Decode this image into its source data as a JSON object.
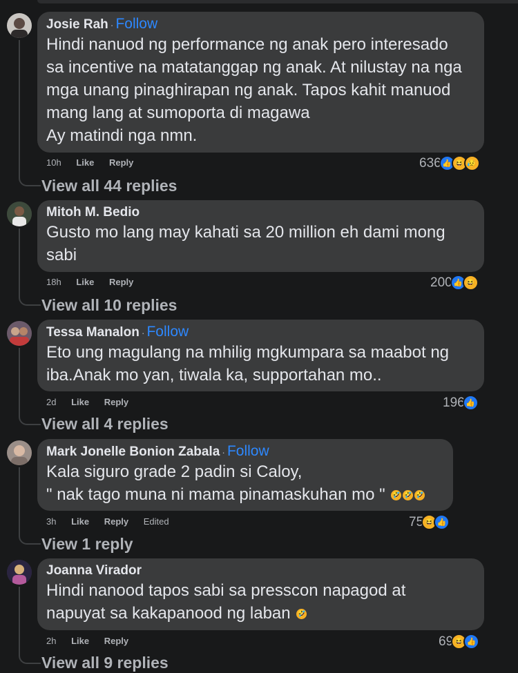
{
  "comments": [
    {
      "name": "Josie Rah",
      "follow": "Follow",
      "lines": [
        "Hindi nanuod ng performance ng anak pero interesado",
        "sa incentive na matatanggap ng anak. At nilustay na nga",
        "mga unang pinaghirapan ng anak. Tapos kahit manuod",
        "mang lang at sumoporta di magawa",
        "Ay matindi nga nmn."
      ],
      "time": "10h",
      "like": "Like",
      "reply": "Reply",
      "count": "636",
      "reactions": [
        "like-icon",
        "haha-icon",
        "sad-icon"
      ],
      "view_replies": "View all 44 replies"
    },
    {
      "name": "Mitoh M. Bedio",
      "lines": [
        "Gusto mo lang may kahati sa 20 million eh dami mong",
        "sabi"
      ],
      "time": "18h",
      "like": "Like",
      "reply": "Reply",
      "count": "200",
      "reactions": [
        "like-icon",
        "haha-icon"
      ],
      "view_replies": "View all 10 replies"
    },
    {
      "name": "Tessa Manalon",
      "follow": "Follow",
      "lines": [
        "Eto ung magulang na mhilig mgkumpara sa maabot ng",
        "iba.Anak mo yan, tiwala ka, supportahan mo.."
      ],
      "time": "2d",
      "like": "Like",
      "reply": "Reply",
      "count": "196",
      "reactions": [
        "like-icon"
      ],
      "view_replies": "View all 4 replies"
    },
    {
      "name": "Mark Jonelle Bonion Zabala",
      "follow": "Follow",
      "lines": [
        "Kala siguro grade 2 padin si Caloy,",
        "\" nak tago muna ni mama pinamaskuhan mo \""
      ],
      "time": "3h",
      "like": "Like",
      "reply": "Reply",
      "edited": "Edited",
      "count": "75",
      "reactions": [
        "haha-icon",
        "like-icon"
      ],
      "view_replies": "View 1 reply"
    },
    {
      "name": "Joanna Virador",
      "lines": [
        "Hindi nanood tapos sabi sa presscon napagod at",
        "napuyat sa kakapanood ng laban"
      ],
      "time": "2h",
      "like": "Like",
      "reply": "Reply",
      "count": "69",
      "reactions": [
        "haha-icon",
        "like-icon"
      ],
      "view_replies": "View all 9 replies"
    }
  ],
  "colors": {
    "background": "#18191a",
    "bubble": "#3a3b3c",
    "follow": "#2d88ff",
    "like": "#2078f4",
    "haha": "#f7b125"
  }
}
